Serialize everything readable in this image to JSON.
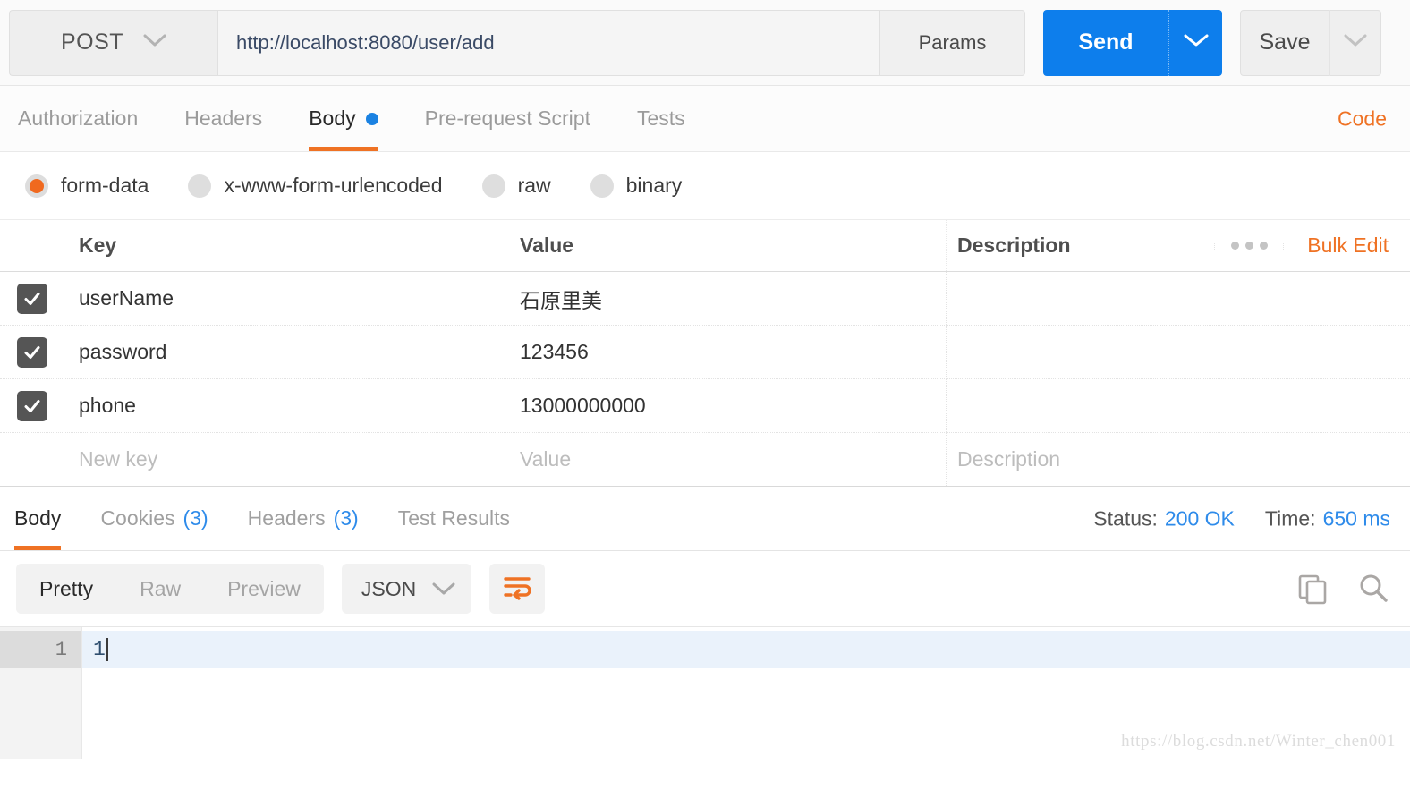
{
  "request_bar": {
    "method": "POST",
    "url": "http://localhost:8080/user/add",
    "params_label": "Params",
    "send_label": "Send",
    "save_label": "Save"
  },
  "request_tabs": {
    "items": [
      {
        "label": "Authorization",
        "active": false,
        "has_dot": false
      },
      {
        "label": "Headers",
        "active": false,
        "has_dot": false
      },
      {
        "label": "Body",
        "active": true,
        "has_dot": true
      },
      {
        "label": "Pre-request Script",
        "active": false,
        "has_dot": false
      },
      {
        "label": "Tests",
        "active": false,
        "has_dot": false
      }
    ],
    "code_link": "Code"
  },
  "body_modes": {
    "options": [
      {
        "label": "form-data",
        "selected": true
      },
      {
        "label": "x-www-form-urlencoded",
        "selected": false
      },
      {
        "label": "raw",
        "selected": false
      },
      {
        "label": "binary",
        "selected": false
      }
    ]
  },
  "kv_table": {
    "headers": {
      "key": "Key",
      "value": "Value",
      "description": "Description"
    },
    "bulk_edit_label": "Bulk Edit",
    "rows": [
      {
        "checked": true,
        "key": "userName",
        "value": "石原里美",
        "description": ""
      },
      {
        "checked": true,
        "key": "password",
        "value": "123456",
        "description": ""
      },
      {
        "checked": true,
        "key": "phone",
        "value": "13000000000",
        "description": ""
      }
    ],
    "placeholder_row": {
      "key": "New key",
      "value": "Value",
      "description": "Description"
    }
  },
  "response_tabs": {
    "items": [
      {
        "label": "Body",
        "count": "",
        "active": true
      },
      {
        "label": "Cookies",
        "count": "(3)",
        "active": false
      },
      {
        "label": "Headers",
        "count": "(3)",
        "active": false
      },
      {
        "label": "Test Results",
        "count": "",
        "active": false
      }
    ],
    "status_label": "Status:",
    "status_value": "200 OK",
    "time_label": "Time:",
    "time_value": "650 ms"
  },
  "response_toolbar": {
    "view_modes": [
      {
        "label": "Pretty",
        "active": true
      },
      {
        "label": "Raw",
        "active": false
      },
      {
        "label": "Preview",
        "active": false
      }
    ],
    "format": "JSON"
  },
  "response_body": {
    "line_number": "1",
    "line_text": "1"
  },
  "watermark": "https://blog.csdn.net/Winter_chen001",
  "colors": {
    "accent_orange": "#ef7224",
    "accent_blue": "#0d7eec",
    "link_blue": "#2e8bea",
    "checkbox_dark": "#555555"
  }
}
